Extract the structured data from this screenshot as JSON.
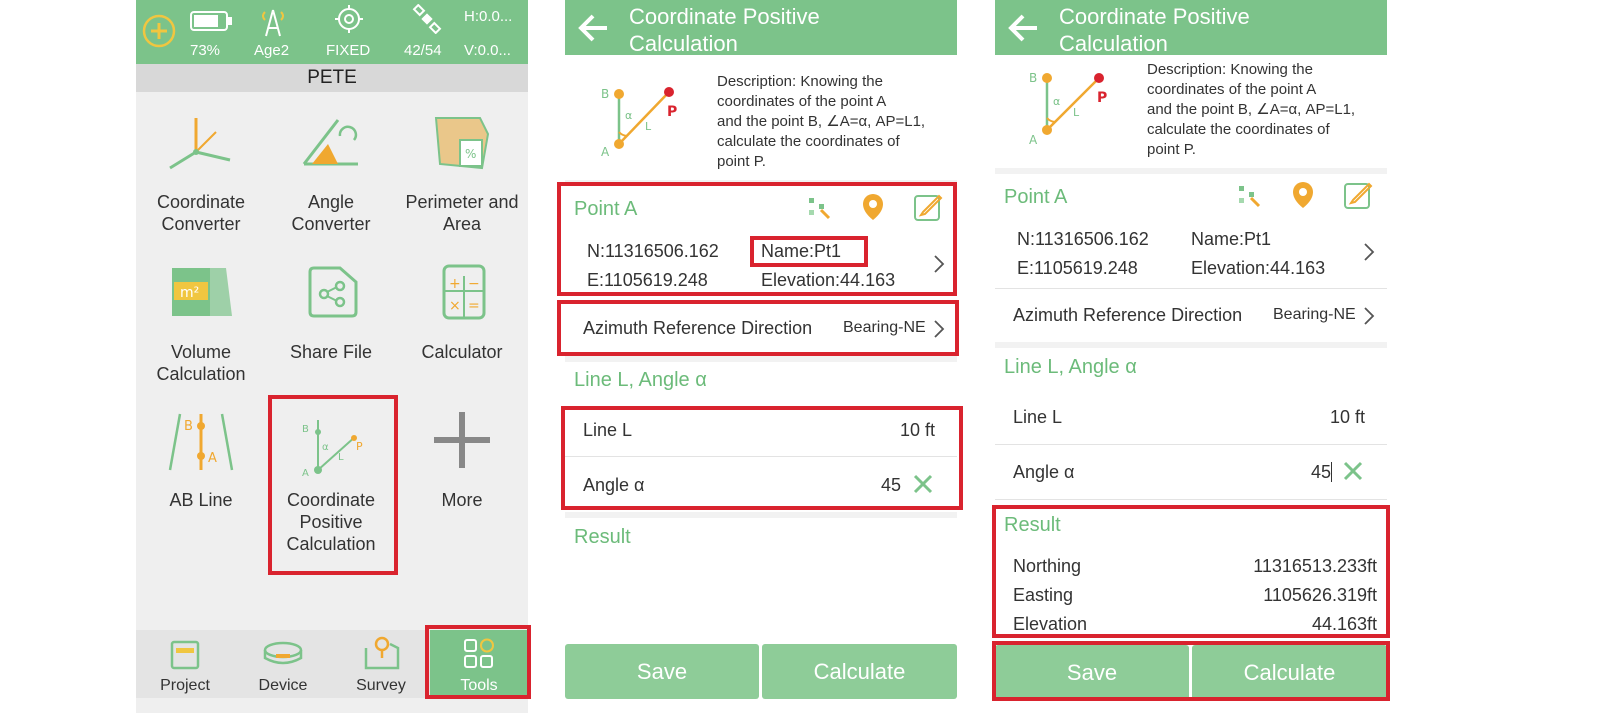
{
  "screen1": {
    "status": {
      "battery_pct": "73%",
      "age": "Age2",
      "fix": "FIXED",
      "sats": "42/54",
      "h": "H:0.0...",
      "v": "V:0.0..."
    },
    "project_name": "PETE",
    "tools": [
      {
        "line1": "Coordinate",
        "line2": "Converter"
      },
      {
        "line1": "Angle",
        "line2": "Converter"
      },
      {
        "line1": "Perimeter and",
        "line2": "Area"
      },
      {
        "line1": "Volume",
        "line2": "Calculation"
      },
      {
        "line1": "Share File",
        "line2": ""
      },
      {
        "line1": "Calculator",
        "line2": ""
      },
      {
        "line1": "AB Line",
        "line2": ""
      },
      {
        "line1": "Coordinate",
        "line2": "Positive",
        "line3": "Calculation"
      },
      {
        "line1": "More",
        "line2": ""
      }
    ],
    "icon_text": {
      "m2": "m²",
      "ab_b": "B",
      "ab_a": "A",
      "pt_b": "B",
      "pt_a": "A",
      "pt_p": "P",
      "pt_alpha": "α",
      "pt_l": "L"
    },
    "nav": [
      "Project",
      "Device",
      "Survey",
      "Tools"
    ]
  },
  "calc": {
    "title_line1": "Coordinate Positive",
    "title_line2": "Calculation",
    "description": [
      "Description: Knowing the",
      "coordinates of the point A",
      "and the point B, ∠A=α, AP=L1,",
      "calculate the coordinates of",
      "point P."
    ],
    "diagram": {
      "b": "B",
      "a": "A",
      "p": "P",
      "alpha": "α",
      "l": "L"
    },
    "point_a_label": "Point A",
    "northing": "N:11316506.162",
    "easting": "E:1105619.248",
    "name": "Name:Pt1",
    "elevation": "Elevation:44.163",
    "azimuth_label": "Azimuth Reference Direction",
    "azimuth_value": "Bearing-NE",
    "line_angle_section": "Line L, Angle α",
    "line_l_label": "Line L",
    "line_l_value": "10 ft",
    "angle_label": "Angle α",
    "angle_value": "45",
    "result_label": "Result",
    "result_rows": [
      {
        "label": "Northing",
        "value": "11316513.233ft"
      },
      {
        "label": "Easting",
        "value": "1105626.319ft"
      },
      {
        "label": "Elevation",
        "value": "44.163ft"
      }
    ],
    "save_label": "Save",
    "calculate_label": "Calculate"
  },
  "colors": {
    "accent_green": "#7cc38a",
    "highlight_red": "#d9232e",
    "icon_orange": "#f0a830"
  }
}
